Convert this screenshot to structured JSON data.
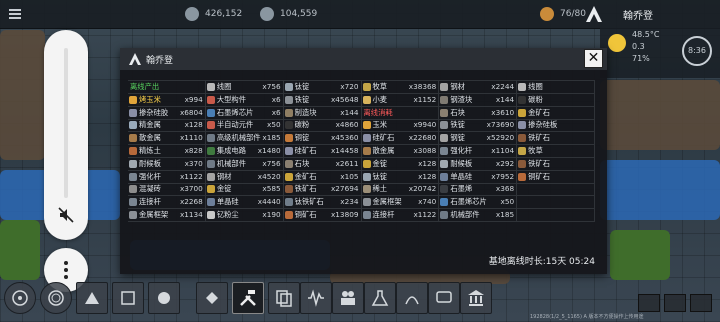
{
  "topbar": {
    "stat1": "426,152",
    "stat2": "104,559",
    "dupes": "76/80",
    "colony_name": "翰乔登"
  },
  "weather": {
    "temp": "48.5°C",
    "rain": "0.3",
    "humidity": "71%",
    "cycle": "8:36"
  },
  "dialog": {
    "title": "翰乔登",
    "close_label": "✕",
    "footer": "基地离线时长:15天 05:24",
    "rows": [
      [
        {
          "name": "离线产出",
          "count": "",
          "cls": "hd-green",
          "color": ""
        },
        {
          "name": "线圈",
          "count": "x756",
          "color": "#b9b9b9"
        },
        {
          "name": "钛锭",
          "count": "x720",
          "color": "#9aa6b1"
        },
        {
          "name": "牧草",
          "count": "x38368",
          "color": "#c4a647"
        },
        {
          "name": "钢材",
          "count": "x2244",
          "color": "#a3a3a3"
        },
        {
          "name": "线圈",
          "count": "",
          "color": "#b9b9b9"
        }
      ],
      [
        {
          "name": "烤玉米",
          "count": "x994",
          "color": "#e0a43a",
          "cls": "hd-yellow"
        },
        {
          "name": "大型构件",
          "count": "x6",
          "color": "#c85a4a"
        },
        {
          "name": "铁锭",
          "count": "x45648",
          "color": "#8b9096"
        },
        {
          "name": "小麦",
          "count": "x1152",
          "color": "#d8b35c"
        },
        {
          "name": "钢渣块",
          "count": "x144",
          "color": "#7f7a72"
        },
        {
          "name": "碳粉",
          "count": "",
          "color": "#333"
        }
      ],
      [
        {
          "name": "掺杂硅胶",
          "count": "x6804",
          "color": "#8a8fa6"
        },
        {
          "name": "石墨烯芯片",
          "count": "x6",
          "color": "#4a7fb5"
        },
        {
          "name": "制造块",
          "count": "x144",
          "color": "#8f7e63"
        },
        {
          "name": "离线消耗",
          "count": "",
          "cls": "hd-red",
          "color": ""
        },
        {
          "name": "石块",
          "count": "x3610",
          "color": "#8a7f70"
        },
        {
          "name": "金矿石",
          "count": "",
          "color": "#caa43a"
        }
      ],
      [
        {
          "name": "精金属",
          "count": "x128",
          "color": "#9ab"
        },
        {
          "name": "半自动元件",
          "count": "x50",
          "color": "#c85a4a"
        },
        {
          "name": "碳粉",
          "count": "x4860",
          "color": "#333"
        },
        {
          "name": "玉米",
          "count": "x9940",
          "color": "#e0a43a"
        },
        {
          "name": "铁锭",
          "count": "x73690",
          "color": "#8b9096"
        },
        {
          "name": "掺杂硅板",
          "count": "",
          "color": "#8a8fa6"
        }
      ],
      [
        {
          "name": "散金属",
          "count": "x1110",
          "color": "#a67b4a"
        },
        {
          "name": "高级机械部件",
          "count": "x185",
          "color": "#6f7a86"
        },
        {
          "name": "铜锭",
          "count": "x45360",
          "color": "#c47a3a"
        },
        {
          "name": "硅矿石",
          "count": "x22680",
          "color": "#8a8fa6"
        },
        {
          "name": "钢锭",
          "count": "x52920",
          "color": "#a3a3a3"
        },
        {
          "name": "铁矿石",
          "count": "",
          "color": "#8a5a3a"
        }
      ],
      [
        {
          "name": "精炼土",
          "count": "x828",
          "color": "#b7693a"
        },
        {
          "name": "集成电路",
          "count": "x1480",
          "color": "#3f7a3f"
        },
        {
          "name": "硅矿石",
          "count": "x14458",
          "color": "#8a8fa6"
        },
        {
          "name": "散金属",
          "count": "x3088",
          "color": "#a67b4a"
        },
        {
          "name": "强化杆",
          "count": "x1104",
          "color": "#7a8591"
        },
        {
          "name": "牧草",
          "count": "",
          "color": "#c4a647"
        }
      ],
      [
        {
          "name": "耐候板",
          "count": "x370",
          "color": "#a0a8b0"
        },
        {
          "name": "机械部件",
          "count": "x756",
          "color": "#6f7a86"
        },
        {
          "name": "石块",
          "count": "x2611",
          "color": "#8a7f70"
        },
        {
          "name": "金锭",
          "count": "x128",
          "color": "#caa43a"
        },
        {
          "name": "耐候板",
          "count": "x292",
          "color": "#a0a8b0"
        },
        {
          "name": "铁矿石",
          "count": "",
          "color": "#8a5a3a"
        }
      ],
      [
        {
          "name": "强化杆",
          "count": "x1122",
          "color": "#7a8591"
        },
        {
          "name": "钢材",
          "count": "x4520",
          "color": "#a3a3a3"
        },
        {
          "name": "金矿石",
          "count": "x105",
          "color": "#caa43a"
        },
        {
          "name": "钛锭",
          "count": "x128",
          "color": "#9aa6b1"
        },
        {
          "name": "单晶硅",
          "count": "x7952",
          "color": "#6d7f9a"
        },
        {
          "name": "铜矿石",
          "count": "",
          "color": "#b86a3a"
        }
      ],
      [
        {
          "name": "混凝砖",
          "count": "x3700",
          "color": "#8d8d8d"
        },
        {
          "name": "金锭",
          "count": "x585",
          "color": "#caa43a"
        },
        {
          "name": "铁矿石",
          "count": "x27694",
          "color": "#8a5a3a"
        },
        {
          "name": "稀土",
          "count": "x20742",
          "color": "#9c8f78"
        },
        {
          "name": "石墨烯",
          "count": "x368",
          "color": "#3a3d42"
        },
        {
          "name": "",
          "count": "",
          "color": ""
        }
      ],
      [
        {
          "name": "连接杆",
          "count": "x2268",
          "color": "#7a8591"
        },
        {
          "name": "单晶硅",
          "count": "x4440",
          "color": "#6d7f9a"
        },
        {
          "name": "钛铁矿石",
          "count": "x234",
          "color": "#707d8a"
        },
        {
          "name": "金属框架",
          "count": "x740",
          "color": "#8b9096"
        },
        {
          "name": "石墨烯芯片",
          "count": "x50",
          "color": "#4a7fb5"
        },
        {
          "name": "",
          "count": "",
          "color": ""
        }
      ],
      [
        {
          "name": "金属框架",
          "count": "x1134",
          "color": "#8b9096"
        },
        {
          "name": "钇粉尘",
          "count": "x190",
          "color": "#c8c8c8"
        },
        {
          "name": "铜矿石",
          "count": "x13809",
          "color": "#b86a3a"
        },
        {
          "name": "连接杆",
          "count": "x1122",
          "color": "#7a8591"
        },
        {
          "name": "机械部件",
          "count": "x185",
          "color": "#6f7a86"
        },
        {
          "name": "",
          "count": "",
          "color": ""
        }
      ]
    ]
  },
  "slider": {
    "level": 0
  },
  "bottom": {
    "build_label": "",
    "footer_text": "192828(1/2_5_1165)  A 版本不方便操作上传用途"
  },
  "colors": {
    "green_header": "#57d15e",
    "red_header": "#ff5a5a",
    "yellow_item": "#ffd54a"
  }
}
